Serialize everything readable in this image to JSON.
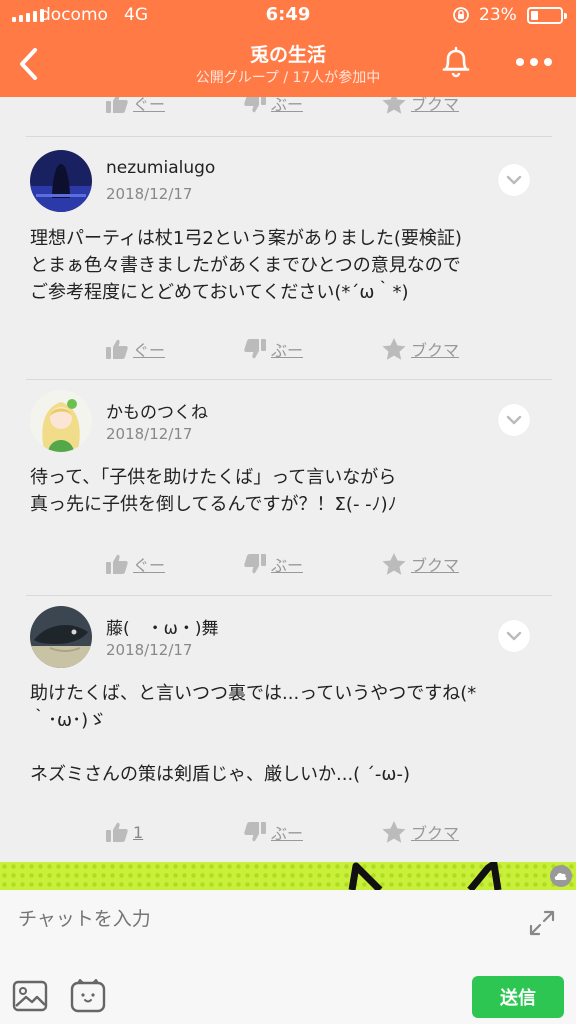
{
  "status_bar": {
    "carrier": "docomo",
    "network": "4G",
    "time": "6:49",
    "battery_percent": "23%",
    "battery_level": 0.23
  },
  "header": {
    "title": "兎の生活",
    "subtitle": "公開グループ / 17人が参加中"
  },
  "reaction_labels": {
    "good": "ぐー",
    "boo": "ぶー",
    "bookmark": "ブクマ"
  },
  "posts": [
    {
      "username": "nezumialugo",
      "date": "2018/12/17",
      "body": "理想パーティは杖1弓2という案がありました(要検証)\nとまぁ色々書きましたがあくまでひとつの意見なので\nご参考程度にとどめておいてください(*´ω｀*)",
      "good": "ぐー"
    },
    {
      "username": "かものつくね",
      "date": "2018/12/17",
      "body": "待って、「子供を助けたくば」って言いながら\n真っ先に子供を倒してるんですが？！Σ(- -ﾉ)ﾉ",
      "good": "ぐー"
    },
    {
      "username": "藤(　・ω・)舞",
      "date": "2018/12/17",
      "body": "助けたくば、と言いつつ裏では...っていうやつですね(*\n｀･ω･)ゞ\n\nネズミさんの策は剣盾じゃ、厳しいか...( ´-ω-)",
      "good": "1"
    }
  ],
  "chat": {
    "placeholder": "チャットを入力",
    "send_label": "送信"
  },
  "colors": {
    "header": "#ff7a45",
    "send": "#2dc653",
    "ad": "#c8f03a"
  }
}
